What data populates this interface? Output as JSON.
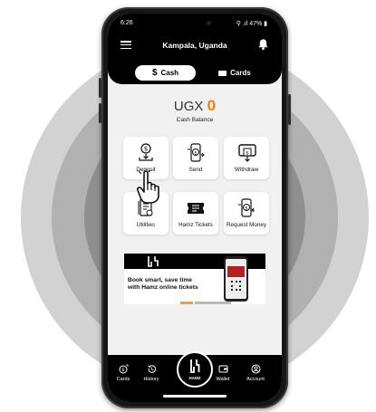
{
  "status_bar": {
    "time": "6:26",
    "right": "47%"
  },
  "app_bar": {
    "location": "Kampala, Uganda"
  },
  "mode_tabs": [
    {
      "label": "Cash",
      "active": true
    },
    {
      "label": "Cards",
      "active": false
    }
  ],
  "balance": {
    "currency": "UGX",
    "amount": "0",
    "label": "Cash Balance"
  },
  "actions": [
    {
      "label": "Deposit",
      "icon": "deposit-icon"
    },
    {
      "label": "Send",
      "icon": "send-icon"
    },
    {
      "label": "Withdraw",
      "icon": "withdraw-icon"
    },
    {
      "label": "Utilities",
      "icon": "utilities-icon"
    },
    {
      "label": "Hamz Tickets",
      "icon": "ticket-icon"
    },
    {
      "label": "Request Money",
      "icon": "request-money-icon"
    }
  ],
  "banner": {
    "text_line1": "Book smart, save time",
    "text_line2": "with Hamz online tickets"
  },
  "bottom_nav": [
    {
      "label": "Cards",
      "icon": "cards-icon"
    },
    {
      "label": "History",
      "icon": "history-icon"
    },
    {
      "label": "HAMZ",
      "icon": "hamz-logo-icon"
    },
    {
      "label": "Wallet",
      "icon": "wallet-icon"
    },
    {
      "label": "Account",
      "icon": "account-icon"
    }
  ],
  "colors": {
    "accent": "#ff7a00",
    "bar": "#000000",
    "screen_bg": "#f1f1f1",
    "ring_1": "#cfcfcf",
    "ring_2": "#a9a9a9",
    "ring_3": "#8a8a8a"
  }
}
